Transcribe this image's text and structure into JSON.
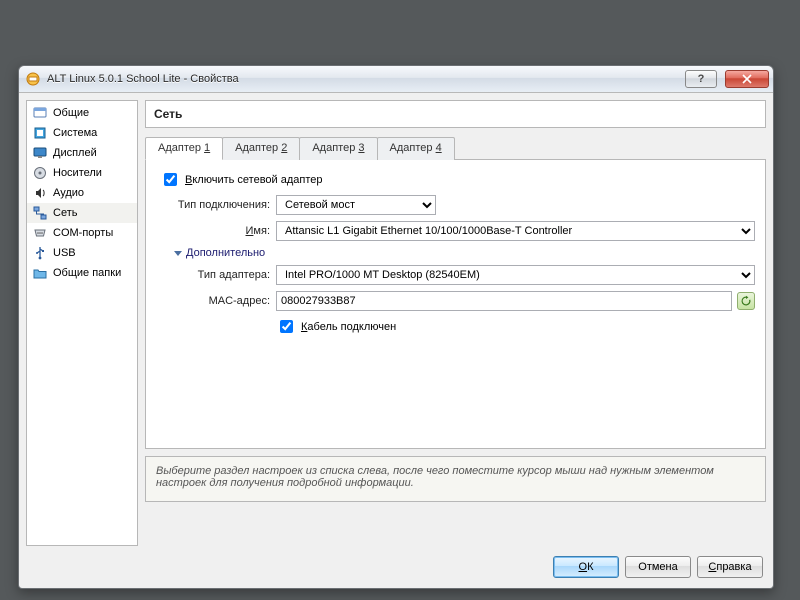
{
  "window": {
    "title": "ALT Linux 5.0.1 School Lite - Свойства"
  },
  "sidebar": {
    "items": [
      {
        "label": "Общие",
        "icon": "general-icon"
      },
      {
        "label": "Система",
        "icon": "system-icon"
      },
      {
        "label": "Дисплей",
        "icon": "display-icon"
      },
      {
        "label": "Носители",
        "icon": "storage-icon"
      },
      {
        "label": "Аудио",
        "icon": "audio-icon"
      },
      {
        "label": "Сеть",
        "icon": "network-icon",
        "selected": true
      },
      {
        "label": "COM-порты",
        "icon": "serial-icon"
      },
      {
        "label": "USB",
        "icon": "usb-icon"
      },
      {
        "label": "Общие папки",
        "icon": "shared-folders-icon"
      }
    ]
  },
  "heading": "Сеть",
  "tabs": [
    {
      "label": "Адаптер ",
      "key": "1",
      "active": true
    },
    {
      "label": "Адаптер ",
      "key": "2"
    },
    {
      "label": "Адаптер ",
      "key": "3"
    },
    {
      "label": "Адаптер ",
      "key": "4"
    }
  ],
  "form": {
    "enable_adapter_label": "Включить сетевой адаптер",
    "enable_adapter_checked": true,
    "connection_type_label": "Тип подключения:",
    "connection_type_value": "Сетевой мост",
    "name_label": "Имя:",
    "name_value": "Attansic L1 Gigabit Ethernet 10/100/1000Base-T Controller",
    "advanced_label": "Дополнительно",
    "adapter_type_label": "Тип адаптера:",
    "adapter_type_value": "Intel PRO/1000 MT Desktop (82540EM)",
    "mac_label": "MAC-адрес:",
    "mac_value": "080027933B87",
    "cable_label": "Кабель подключен",
    "cable_checked": true
  },
  "hint": "Выберите раздел настроек из списка слева, после чего поместите курсор мыши над нужным элементом настроек для получения подробной информации.",
  "buttons": {
    "ok": "ОК",
    "cancel": "Отмена",
    "help": "Справка"
  },
  "underline": {
    "ok": "О",
    "cancel": "О",
    "help": "С",
    "enable": "В",
    "name": "И",
    "cable": "К"
  }
}
